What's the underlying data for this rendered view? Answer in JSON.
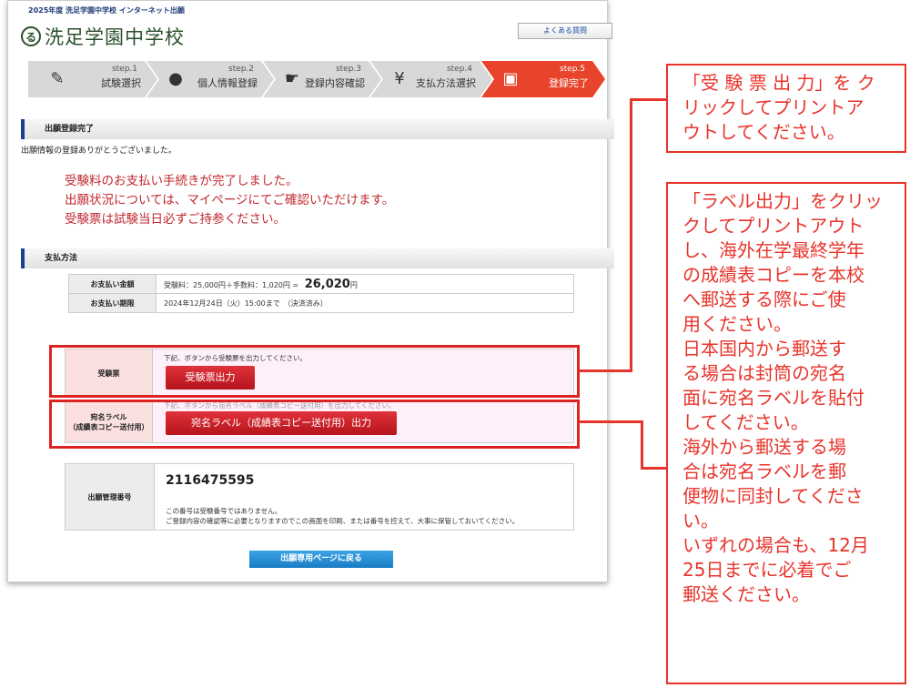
{
  "header": {
    "topline": "2025年度 洗足学園中学校 インターネット出願",
    "school_mark": "る",
    "school_name": "洗足学園中学校",
    "faq_label": "よくある質問"
  },
  "steps": [
    {
      "num": "step.1",
      "label": "試験選択",
      "icon": "pencil-icon"
    },
    {
      "num": "step.2",
      "label": "個人情報登録",
      "icon": "person-icon"
    },
    {
      "num": "step.3",
      "label": "登録内容確認",
      "icon": "hand-icon"
    },
    {
      "num": "step.4",
      "label": "支払方法選択",
      "icon": "yen-icon"
    },
    {
      "num": "step.5",
      "label": "登録完了",
      "icon": "computer-icon"
    }
  ],
  "complete": {
    "section_title": "出願登録完了",
    "thanks": "出願情報の登録ありがとうございました。",
    "messages": [
      "受験料のお支払い手続きが完了しました。",
      "出願状況については、マイページにてご確認いただけます。",
      "受験票は試験当日必ずご持参ください。"
    ]
  },
  "payment": {
    "section_title": "支払方法",
    "amount_label": "お支払い金額",
    "amount_detail": "受験料：25,000円＋手数料：1,020円 =",
    "amount_total": "26,020",
    "amount_unit": "円",
    "deadline_label": "お支払い期限",
    "deadline_value": "2024年12月24日（火）15:00まで　（決済済み）"
  },
  "ticket": {
    "label": "受験票",
    "note": "下記、ボタンから受験票を出力してください。",
    "button": "受験票出力"
  },
  "address_label": {
    "label_line1": "宛名ラベル",
    "label_line2": "（成績表コピー送付用）",
    "note": "下記、ボタンから宛名ラベル（成績表コピー送付用）を出力してください。",
    "button": "宛名ラベル（成績表コピー送付用）出力"
  },
  "management": {
    "label": "出願管理番号",
    "number": "2116475595",
    "note1": "この番号は受験番号ではありません。",
    "note2": "ご登録内容の確認等に必要となりますのでこの画面を印刷、または番号を控えて、大事に保管しておいてください。"
  },
  "back_button": "出願専用ページに戻る",
  "callouts": {
    "ticket": [
      "「受 験 票 出 力」を ク",
      "リックしてプリントア",
      "ウトしてください。"
    ],
    "label": [
      "「ラベル出力」をクリッ",
      "クしてプリントアウト",
      "し、海外在学最終学年",
      "の成績表コピーを本校",
      "へ郵送する際にご使",
      "用ください。",
      "日本国内から郵送す",
      "る場合は封筒の宛名",
      "面に宛名ラベルを貼付",
      "してください。",
      "海外から郵送する場",
      "合は宛名ラベルを郵",
      "便物に同封してくださ",
      "い。",
      "いずれの場合も、12月",
      "25日までに必着でご",
      "郵送ください。"
    ]
  },
  "colors": {
    "accent_red": "#e8342b",
    "step_active": "#e8432b",
    "nav_blue": "#1a3f8f"
  }
}
